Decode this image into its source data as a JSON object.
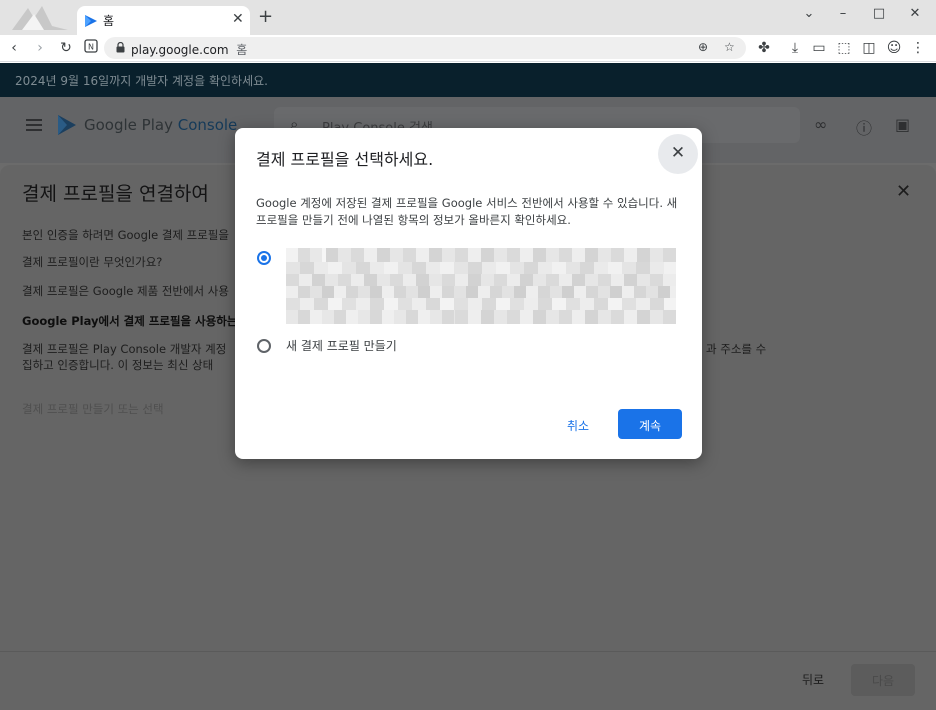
{
  "browser": {
    "tab_title": "홈",
    "tab_close": "✕",
    "new_tab": "+",
    "window_controls": {
      "minimize": "–",
      "maximize": "□",
      "close": "✕",
      "dropdown": "⌄"
    },
    "url_host": "play.google.com",
    "url_path": "홈",
    "icons": [
      "back-icon",
      "forward-icon",
      "reload-icon",
      "extension-n-icon",
      "lock-icon",
      "zoom-icon",
      "bookmark-star-icon",
      "extensions-icon",
      "download-icon",
      "cast-icon",
      "screenshot-icon",
      "sidepanel-icon",
      "profile-icon",
      "menu-icon"
    ]
  },
  "banner": {
    "text": "2024년 9월 16일까지 개발자 계정을 확인하세요."
  },
  "appbar": {
    "product_name": "Google Play",
    "product_suffix": "Console",
    "search_placeholder": "Play Console 검색"
  },
  "sheet": {
    "title": "결제 프로필을 연결하여",
    "p1": "본인 인증을 하려면 Google 결제 프로필을",
    "p2": "결제 프로필이란 무엇인가요?",
    "p3": "결제 프로필은 Google 제품 전반에서 사용",
    "p4": "Google Play에서 결제 프로필을 사용하는",
    "p5": "결제 프로필은 Play Console 개발자 계정",
    "p5_tail": "과 주소를 수",
    "p6": "집하고 인증합니다. 이 정보는 최신 상태",
    "p7": "결제 프로필 만들기 또는 선택",
    "back_label": "뒤로",
    "next_label": "다음"
  },
  "dialog": {
    "title": "결제 프로필을 선택하세요.",
    "description": "Google 계정에 저장된 결제 프로필을 Google 서비스 전반에서 사용할 수 있습니다. 새 프로필을 만들기 전에 나열된 항목의 정보가 올바른지 확인하세요.",
    "options": [
      {
        "label": "",
        "selected": true,
        "redacted": true
      },
      {
        "label": "새 결제 프로필 만들기",
        "selected": false
      }
    ],
    "cancel_label": "취소",
    "continue_label": "계속"
  },
  "colors": {
    "accent": "#1a73e8",
    "banner": "#09202c"
  }
}
